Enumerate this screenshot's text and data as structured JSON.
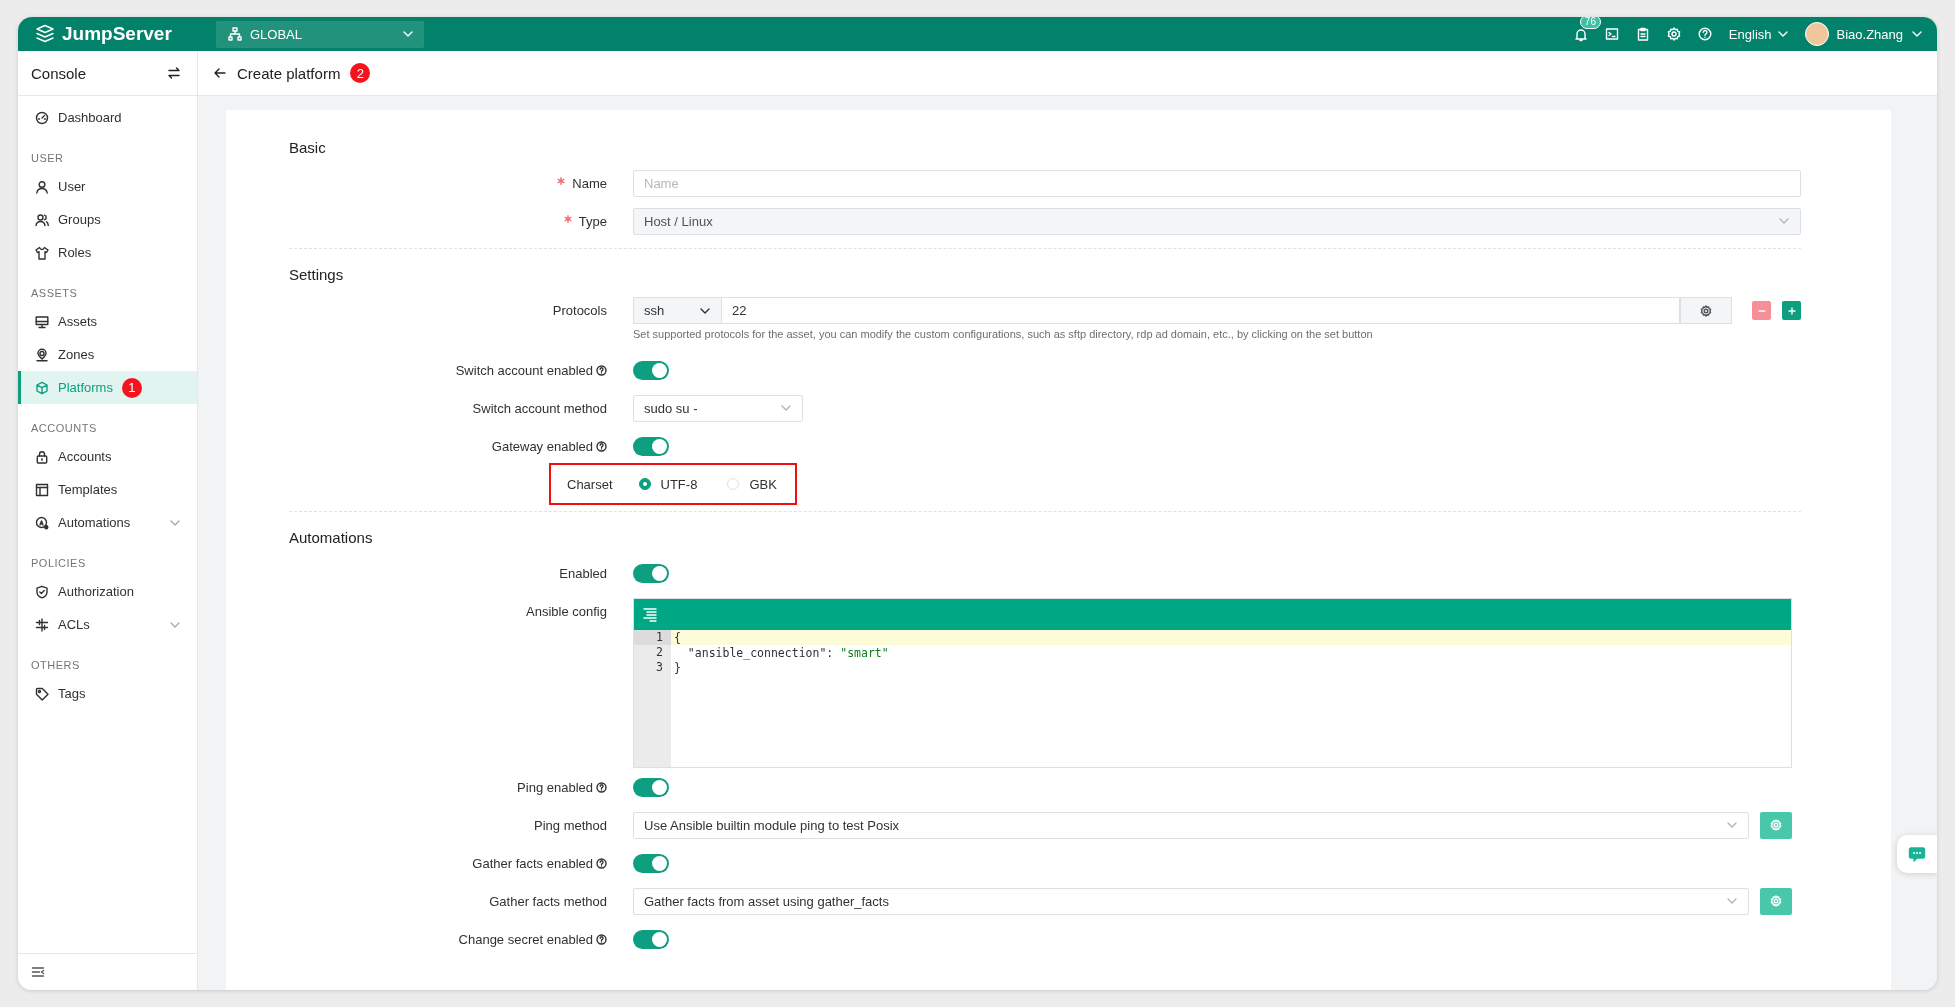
{
  "topbar": {
    "brand": "JumpServer",
    "org": "GLOBAL",
    "notification_count": "76",
    "language": "English",
    "user": "Biao.Zhang"
  },
  "sidebar": {
    "title": "Console",
    "items": [
      {
        "kind": "item",
        "label": "Dashboard",
        "selected": false
      },
      {
        "kind": "section",
        "label": "USER"
      },
      {
        "kind": "item",
        "label": "User",
        "selected": false
      },
      {
        "kind": "item",
        "label": "Groups",
        "selected": false
      },
      {
        "kind": "item",
        "label": "Roles",
        "selected": false
      },
      {
        "kind": "section",
        "label": "ASSETS"
      },
      {
        "kind": "item",
        "label": "Assets",
        "selected": false
      },
      {
        "kind": "item",
        "label": "Zones",
        "selected": false
      },
      {
        "kind": "item",
        "label": "Platforms",
        "selected": true,
        "badge": "1"
      },
      {
        "kind": "section",
        "label": "ACCOUNTS"
      },
      {
        "kind": "item",
        "label": "Accounts",
        "selected": false
      },
      {
        "kind": "item",
        "label": "Templates",
        "selected": false
      },
      {
        "kind": "item",
        "label": "Automations",
        "selected": false,
        "expanded": false
      },
      {
        "kind": "section",
        "label": "POLICIES"
      },
      {
        "kind": "item",
        "label": "Authorization",
        "selected": false
      },
      {
        "kind": "item",
        "label": "ACLs",
        "selected": false,
        "expanded": false
      },
      {
        "kind": "section",
        "label": "OTHERS"
      },
      {
        "kind": "item",
        "label": "Tags",
        "selected": false
      }
    ]
  },
  "header": {
    "title": "Create platform",
    "badge": "2"
  },
  "form": {
    "sections": [
      {
        "title": "Basic",
        "rows": [
          {
            "kind": "input",
            "label": "Name",
            "required": true,
            "placeholder": "Name"
          },
          {
            "kind": "select",
            "label": "Type",
            "required": true,
            "value": "Host / Linux",
            "disabled": true
          }
        ]
      },
      {
        "title": "Settings",
        "rows": [
          {
            "kind": "protocols",
            "label": "Protocols",
            "protocol": "ssh",
            "port": "22",
            "hint": "Set supported protocols for the asset, you can modify the custom configurations, such as sftp directory, rdp ad domain, etc., by clicking on the set button"
          },
          {
            "kind": "switch",
            "label": "Switch account enabled",
            "help": true,
            "on": true
          },
          {
            "kind": "small-select",
            "label": "Switch account method",
            "value": "sudo su -"
          },
          {
            "kind": "switch",
            "label": "Gateway enabled",
            "help": true,
            "on": true
          },
          {
            "kind": "radio",
            "label": "Charset",
            "highlighted": true,
            "options": [
              {
                "label": "UTF-8",
                "selected": true
              },
              {
                "label": "GBK",
                "selected": false
              }
            ]
          }
        ]
      },
      {
        "title": "Automations",
        "rows": [
          {
            "kind": "switch",
            "label": "Enabled",
            "help": false,
            "on": true
          },
          {
            "kind": "code",
            "label": "Ansible config",
            "lines": [
              {
                "number": "1",
                "text": "{",
                "active": true
              },
              {
                "number": "2",
                "text": "  \"ansible_connection\": \"smart\"",
                "active": false
              },
              {
                "number": "3",
                "text": "}",
                "active": false
              }
            ]
          },
          {
            "kind": "switch",
            "label": "Ping enabled",
            "help": true,
            "on": true
          },
          {
            "kind": "select-action",
            "label": "Ping method",
            "value": "Use Ansible builtin module ping to test Posix"
          },
          {
            "kind": "switch",
            "label": "Gather facts enabled",
            "help": true,
            "on": true
          },
          {
            "kind": "select-action",
            "label": "Gather facts method",
            "value": "Gather facts from asset using gather_facts"
          },
          {
            "kind": "switch",
            "label": "Change secret enabled",
            "help": true,
            "on": true
          }
        ]
      }
    ]
  }
}
